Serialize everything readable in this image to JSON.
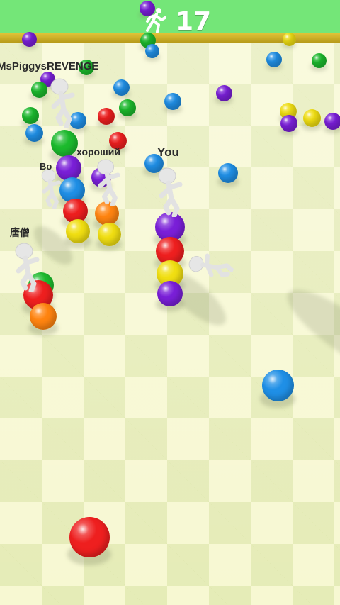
{
  "hud": {
    "players_left": "17",
    "runner_icon": "running-person-icon"
  },
  "players": [
    {
      "id": "you",
      "label": "You"
    },
    {
      "id": "mspiggys",
      "label": "MsPiggysREVENGE"
    },
    {
      "id": "khoroshiy",
      "label": "хороший"
    },
    {
      "id": "bon",
      "label": "Bo"
    },
    {
      "id": "tangseng",
      "label": "唐僧"
    }
  ],
  "colors": {
    "blue": "#1f8fe6",
    "purple": "#7a1fd8",
    "red": "#ee1f1f",
    "yellow": "#f1df12",
    "green": "#1cba2d",
    "orange": "#ff8410",
    "sky": "#74e678",
    "wall": "#d7b82c",
    "floor": "#f7f8d2"
  }
}
